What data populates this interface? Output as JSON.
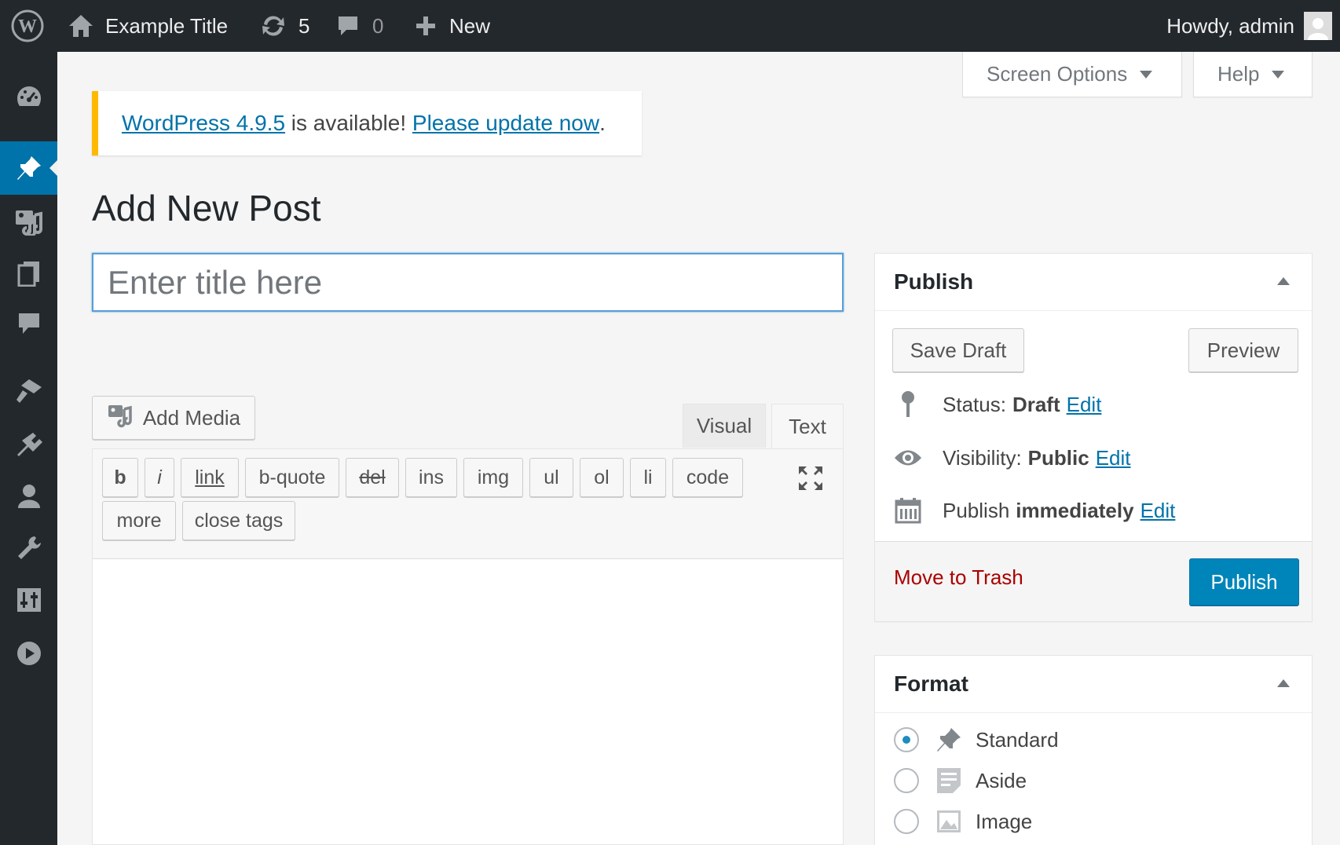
{
  "admin_bar": {
    "site_title": "Example Title",
    "updates_count": "5",
    "comments_count": "0",
    "new_label": "New",
    "greeting": "Howdy, admin"
  },
  "screen_meta": {
    "screen_options": "Screen Options",
    "help": "Help"
  },
  "notice": {
    "version_link": "WordPress 4.9.5",
    "middle_text": " is available! ",
    "update_link": "Please update now",
    "end_text": "."
  },
  "page_title": "Add New Post",
  "title_field": {
    "placeholder": "Enter title here",
    "value": ""
  },
  "editor": {
    "add_media": "Add Media",
    "tabs": [
      "Visual",
      "Text"
    ],
    "active_tab": "Text",
    "quicktags": [
      "b",
      "i",
      "link",
      "b-quote",
      "del",
      "ins",
      "img",
      "ul",
      "ol",
      "li",
      "code",
      "more",
      "close tags"
    ]
  },
  "publish_box": {
    "title": "Publish",
    "save_draft": "Save Draft",
    "preview": "Preview",
    "status_label": "Status:",
    "status_value": "Draft",
    "visibility_label": "Visibility:",
    "visibility_value": "Public",
    "schedule_label": "Publish",
    "schedule_value": "immediately",
    "edit_link": "Edit",
    "move_to_trash": "Move to Trash",
    "publish_button": "Publish"
  },
  "format_box": {
    "title": "Format",
    "options": [
      "Standard",
      "Aside",
      "Image"
    ],
    "selected": "Standard"
  },
  "colors": {
    "admin_bar_bg": "#23282d",
    "accent_blue": "#0073aa",
    "publish_button": "#0085ba",
    "notice_warning": "#ffb900",
    "trash_red": "#a00"
  },
  "sidebar_icons": [
    "dashboard-icon",
    "posts-icon",
    "media-icon",
    "pages-icon",
    "comments-icon",
    "appearance-icon",
    "plugins-icon",
    "users-icon",
    "tools-icon",
    "settings-icon",
    "collapse-icon"
  ]
}
